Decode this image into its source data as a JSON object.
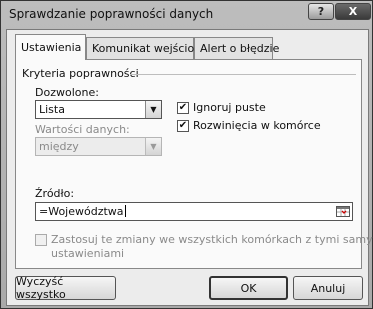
{
  "window": {
    "title": "Sprawdzanie poprawności danych",
    "help_glyph": "?",
    "close_glyph": "X"
  },
  "tabs": [
    {
      "label": "Ustawienia",
      "active": true
    },
    {
      "label": "Komunikat wejściowy",
      "active": false
    },
    {
      "label": "Alert o błędzie",
      "active": false
    }
  ],
  "criteria": {
    "group_label": "Kryteria poprawności",
    "allow": {
      "label": "Dozwolone:",
      "value": "Lista"
    },
    "data": {
      "label": "Wartości danych:",
      "value": "między",
      "disabled": true
    },
    "ignore_blank": {
      "label": "Ignoruj puste",
      "checked": true
    },
    "in_cell_dropdown": {
      "label": "Rozwinięcia w komórce",
      "checked": true
    },
    "source": {
      "label": "Źródło:",
      "value": "=Województwa"
    }
  },
  "apply_all": {
    "line1": "Zastosuj te zmiany we wszystkich komórkach z tymi samymi",
    "line2": "ustawieniami",
    "checked": false,
    "disabled": true
  },
  "buttons": {
    "clear_all": "Wyczyść wszystko",
    "ok": "OK",
    "cancel": "Anuluj"
  },
  "icons": {
    "dropdown_arrow": "chevron-down-icon",
    "checkmark": "check-icon",
    "collapse_dialog": "collapse-dialog-icon"
  }
}
